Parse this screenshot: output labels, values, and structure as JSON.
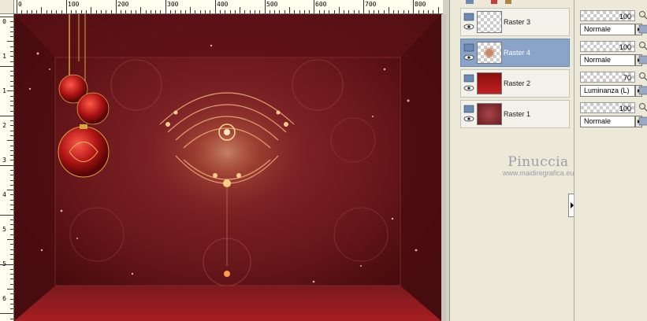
{
  "rulers": {
    "top_labels": [
      "0",
      "100",
      "200",
      "300",
      "400",
      "500",
      "600",
      "700",
      "800"
    ],
    "left_labels": [
      "0",
      "1",
      "1",
      "2",
      "3",
      "4",
      "5",
      "5",
      "6"
    ]
  },
  "layers": [
    {
      "name": "Raster 3",
      "selected": false,
      "thumb": "ornament"
    },
    {
      "name": "Raster 4",
      "selected": true,
      "thumb": "fractal"
    },
    {
      "name": "Raster 2",
      "selected": false,
      "thumb": "redframe"
    },
    {
      "name": "Raster 1",
      "selected": false,
      "thumb": "background"
    }
  ],
  "properties": [
    {
      "opacity": "100",
      "blend": "Normale"
    },
    {
      "opacity": "100",
      "blend": "Normale"
    },
    {
      "opacity": "70",
      "blend": "Luminanza (L)"
    },
    {
      "opacity": "100",
      "blend": "Normale"
    }
  ],
  "watermark": {
    "name": "Pinuccia",
    "site": "www.maidiregrafica.eu"
  },
  "colors": {
    "selected_row": "#8aa3c9",
    "canvas_base": "#5a1014",
    "panel_bg": "#ece9d8"
  }
}
